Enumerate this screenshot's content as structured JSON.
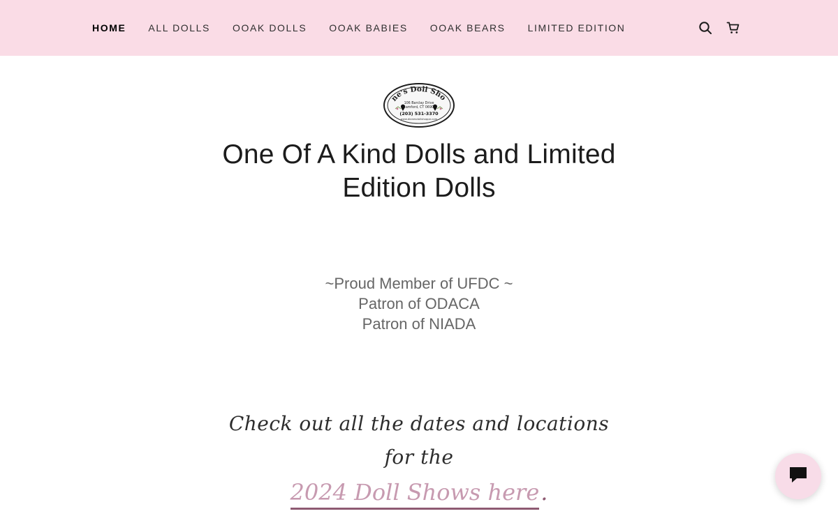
{
  "header": {
    "nav": [
      {
        "label": "HOME",
        "active": true
      },
      {
        "label": "ALL DOLLS",
        "active": false
      },
      {
        "label": "OOAK DOLLS",
        "active": false
      },
      {
        "label": "OOAK BABIES",
        "active": false
      },
      {
        "label": "OOAK BEARS",
        "active": false
      },
      {
        "label": "LIMITED EDITION",
        "active": false
      }
    ],
    "actions": [
      {
        "icon": "search-icon"
      },
      {
        "icon": "cart-icon"
      }
    ]
  },
  "logo": {
    "title": "Diane's Doll Shoppe",
    "address_line1": "106 Barclay Drive",
    "address_line2": "Stamford, CT 06903",
    "phone": "(203) 531-3370",
    "website": "www.dianesdollshoppe.com"
  },
  "hero": {
    "headline_line1": "One Of A Kind Dolls and Limited",
    "headline_line2": "Edition Dolls"
  },
  "memberships": {
    "line1": "~Proud Member of UFDC ~",
    "line2": "Patron of ODACA",
    "line3": "Patron of NIADA"
  },
  "promo": {
    "text": "Check out all the dates and locations for the",
    "link_text": "2024 Doll Shows here",
    "trailing_punctuation": "."
  },
  "chat": {
    "icon": "chat-icon"
  },
  "colors": {
    "header_bg": "#fadce6",
    "accent_pink": "#c79ab0",
    "accent_plum": "#8e5a72",
    "text_dark": "#1c1c1c",
    "text_gray": "#666666",
    "chat_bg": "#f8dce8"
  }
}
